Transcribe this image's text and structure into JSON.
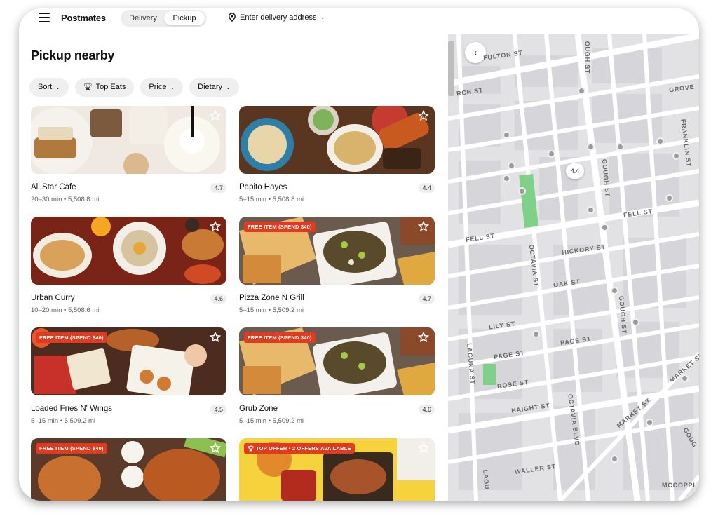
{
  "header": {
    "brand": "Postmates",
    "modes": [
      "Delivery",
      "Pickup"
    ],
    "active_mode": "Pickup",
    "address_placeholder": "Enter delivery address"
  },
  "page": {
    "title": "Pickup nearby"
  },
  "filters": [
    {
      "label": "Sort",
      "icon": "chevron-down-icon"
    },
    {
      "label": "Top Eats",
      "icon": "trophy-icon"
    },
    {
      "label": "Price",
      "icon": "chevron-down-icon"
    },
    {
      "label": "Dietary",
      "icon": "chevron-down-icon"
    }
  ],
  "restaurants": [
    {
      "name": "All Star Cafe",
      "meta": "20–30 min • 5,508.8 mi",
      "rating": "4.7",
      "badge": ""
    },
    {
      "name": "Papito Hayes",
      "meta": "5–15 min • 5,508.8 mi",
      "rating": "4.4",
      "badge": ""
    },
    {
      "name": "Urban Curry",
      "meta": "10–20 min • 5,508.6 mi",
      "rating": "4.6",
      "badge": ""
    },
    {
      "name": "Pizza Zone N Grill",
      "meta": "5–15 min • 5,509.2 mi",
      "rating": "4.7",
      "badge": "FREE ITEM (SPEND $40)"
    },
    {
      "name": "Loaded Fries N' Wings",
      "meta": "5–15 min • 5,509.2 mi",
      "rating": "4.5",
      "badge": "FREE ITEM (SPEND $40)"
    },
    {
      "name": "Grub Zone",
      "meta": "5–15 min • 5,509.2 mi",
      "rating": "4.6",
      "badge": "FREE ITEM (SPEND $40)"
    },
    {
      "name": "",
      "meta": "",
      "rating": "",
      "badge": "FREE ITEM (SPEND $40)"
    },
    {
      "name": "",
      "meta": "",
      "rating": "",
      "badge": "TOP OFFER • 2 OFFERS AVAILABLE"
    }
  ],
  "map": {
    "back_icon": "chevron-left-icon",
    "pin_label": "4.4",
    "streets": [
      "FULTON ST",
      "RCH ST",
      "GROVE",
      "GOUGH ST",
      "FRANKLIN ST",
      "FELL ST",
      "FELL ST",
      "HICKORY ST",
      "OAK ST",
      "OCTAVIA ST",
      "LILY ST",
      "PAGE ST",
      "PAGE ST",
      "GOUGH ST",
      "ROSE ST",
      "LAGUNA ST",
      "HAIGHT ST",
      "OCTAVIA BLVD",
      "MARKET ST",
      "MARKET ST",
      "WALLER ST",
      "LAGU",
      "MCCOPPI",
      "GOUG",
      "OUGH ST"
    ]
  },
  "colors": {
    "accent_badge": "#e2391f",
    "map_bg": "#e8e8ea",
    "park": "#7fd18a"
  }
}
